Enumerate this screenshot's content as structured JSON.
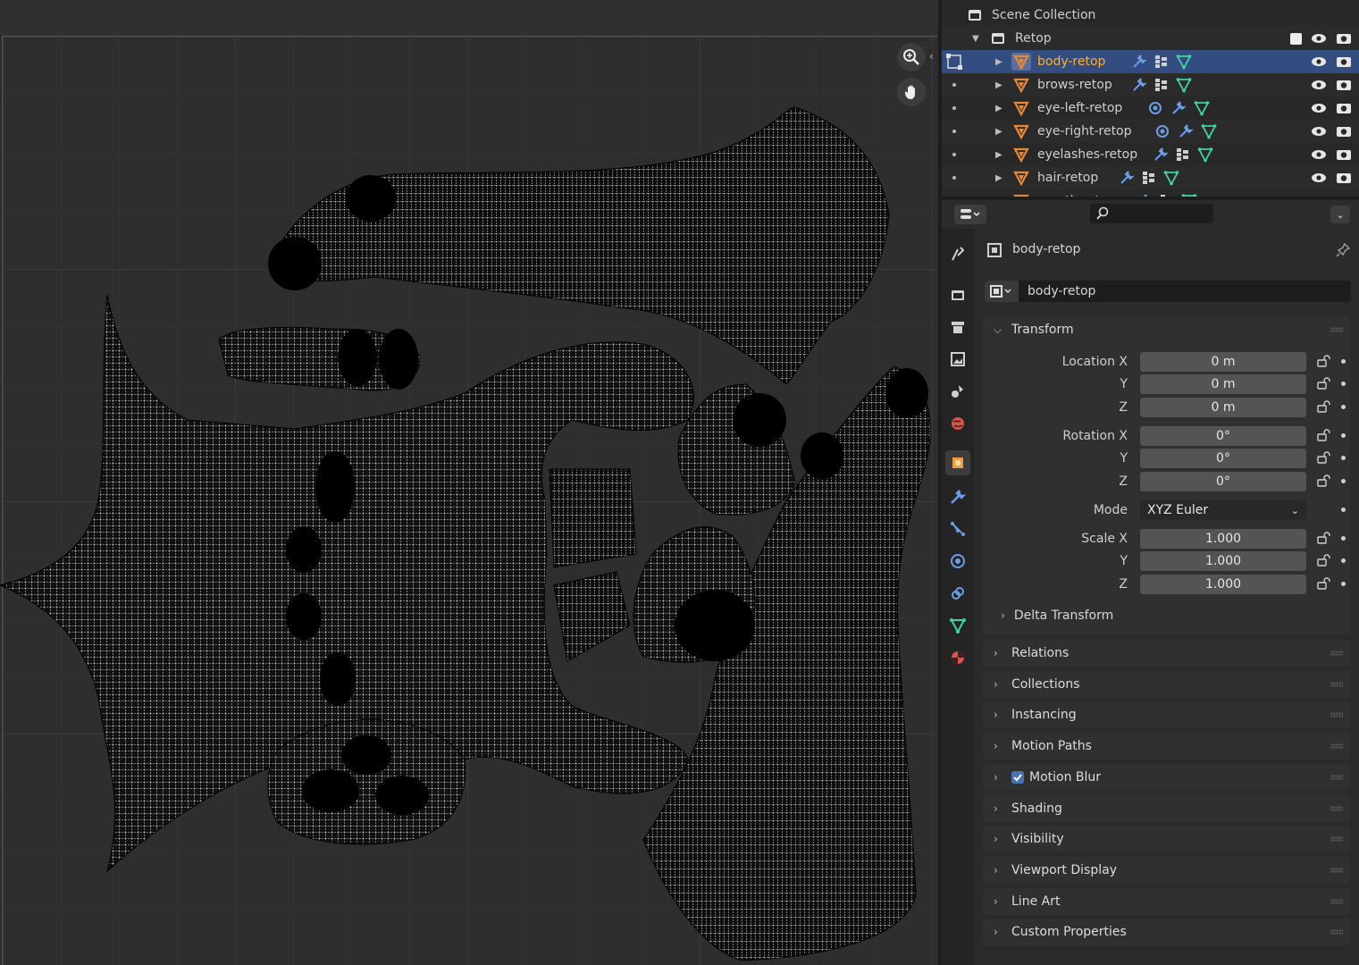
{
  "outliner": {
    "scene_collection": "Scene Collection",
    "collection": "Retop",
    "objects": [
      {
        "name": "body-retop",
        "selected": true
      },
      {
        "name": "brows-retop",
        "selected": false
      },
      {
        "name": "eye-left-retop",
        "selected": false
      },
      {
        "name": "eye-right-retop",
        "selected": false
      },
      {
        "name": "eyelashes-retop",
        "selected": false
      },
      {
        "name": "hair-retop",
        "selected": false
      },
      {
        "name": "mouth-retop",
        "selected": false
      }
    ]
  },
  "properties": {
    "context_object": "body-retop",
    "object_name": "body-retop",
    "transform": {
      "title": "Transform",
      "location_label": "Location X",
      "rotation_label": "Rotation X",
      "mode_label": "Mode",
      "scale_label": "Scale X",
      "y_label": "Y",
      "z_label": "Z",
      "location": [
        "0 m",
        "0 m",
        "0 m"
      ],
      "rotation": [
        "0°",
        "0°",
        "0°"
      ],
      "mode": "XYZ Euler",
      "scale": [
        "1.000",
        "1.000",
        "1.000"
      ],
      "delta": "Delta Transform"
    },
    "panels": [
      "Relations",
      "Collections",
      "Instancing",
      "Motion Paths",
      "Motion Blur",
      "Shading",
      "Visibility",
      "Viewport Display",
      "Line Art",
      "Custom Properties"
    ]
  },
  "colors": {
    "accent": "#ffaf29",
    "selection": "#334d80",
    "mesh_icon": "#e8893a",
    "data_icon": "#3fd4a4",
    "modifier_icon": "#6b9ee8"
  }
}
